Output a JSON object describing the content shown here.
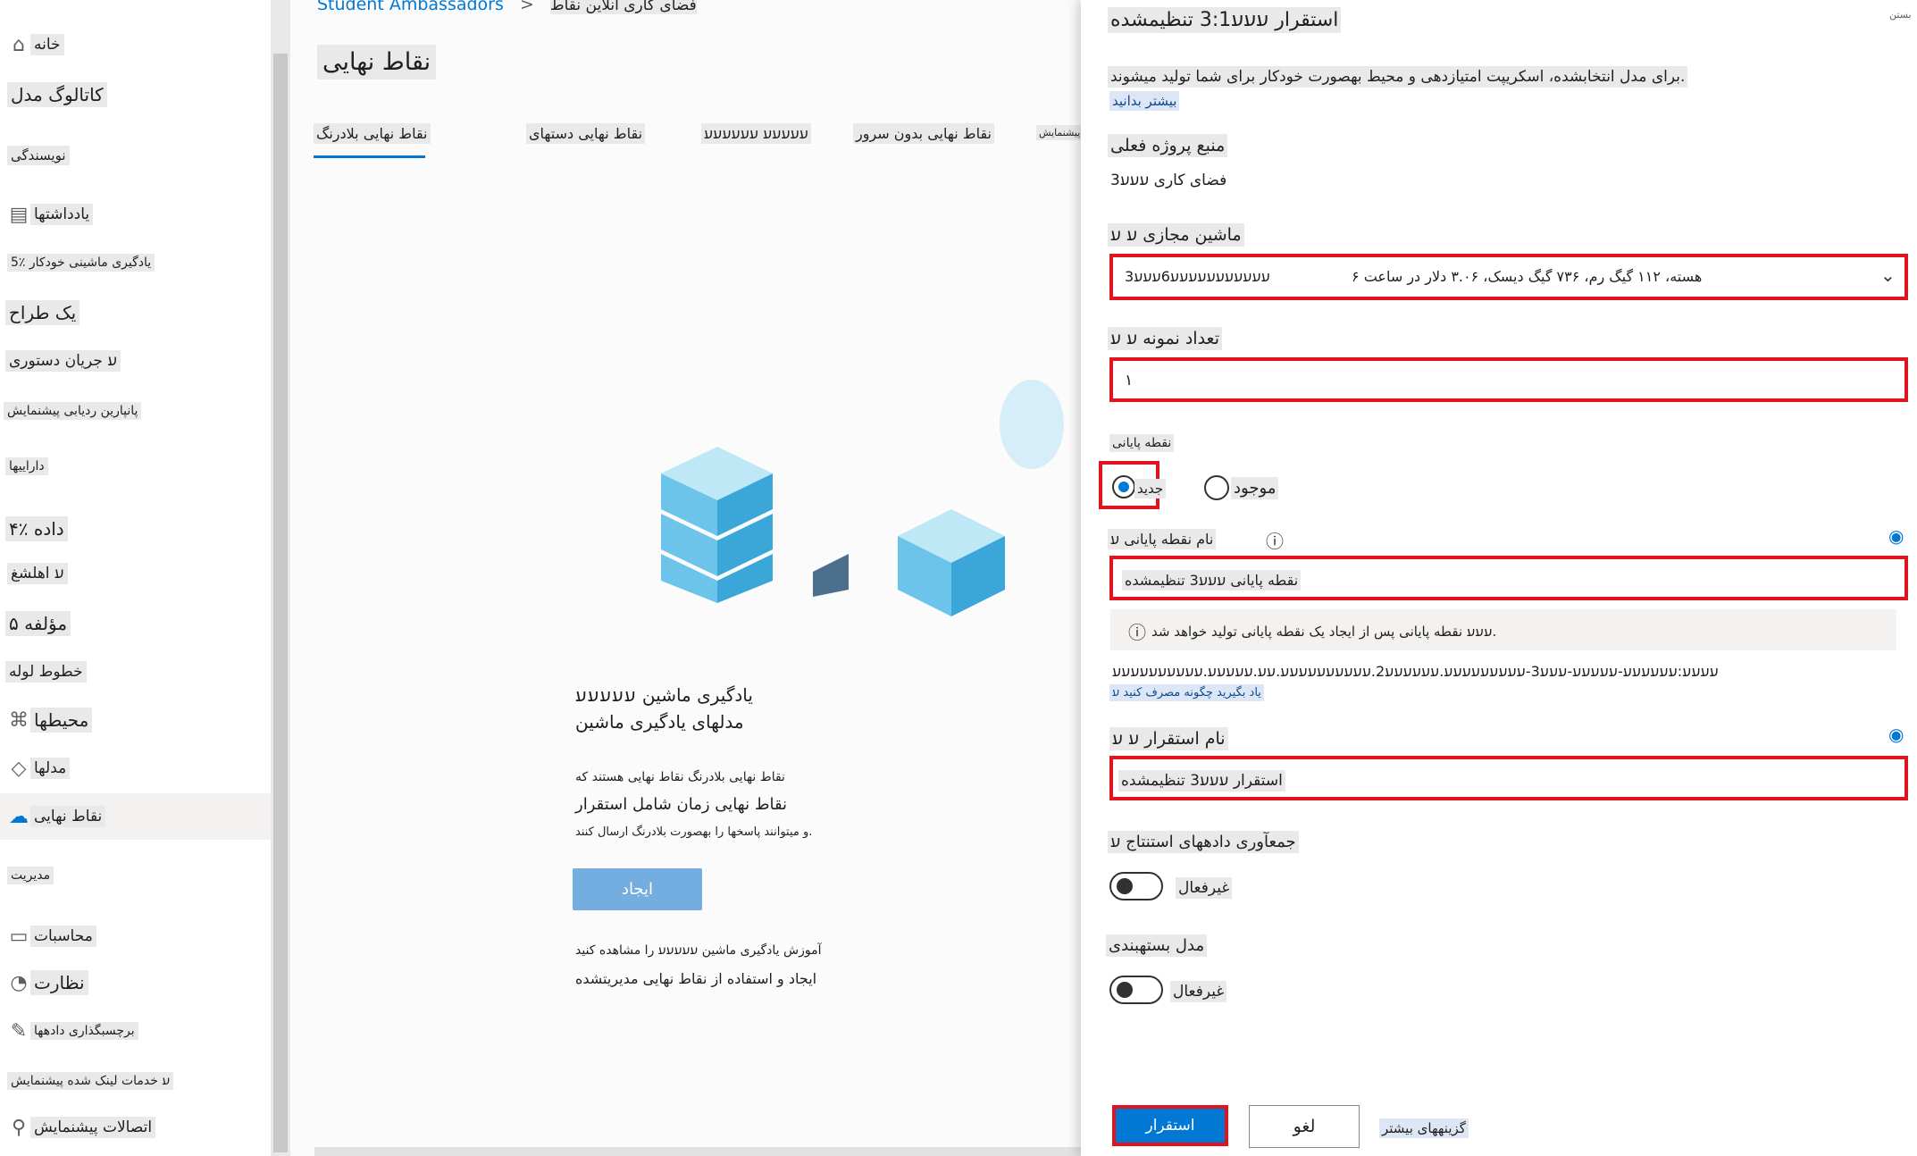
{
  "nav": {
    "items": [
      {
        "label": "خانه",
        "icon": "home-icon"
      },
      {
        "label": "کاتالوگ مدل",
        "icon": ""
      },
      {
        "label": "نویسندگی",
        "icon": ""
      },
      {
        "label": "یادداشتها",
        "icon": "notebook-icon"
      },
      {
        "label": "5٪ یادگیری ماشینی خودکار",
        "icon": ""
      },
      {
        "label": "یک طراح",
        "icon": ""
      },
      {
        "label": "ﬠ جریان دستوری",
        "icon": ""
      },
      {
        "label": "پانپارین ردیابی پیشنمایش",
        "icon": ""
      },
      {
        "label": "داراییها",
        "icon": ""
      },
      {
        "label": "۴٪ داده",
        "icon": ""
      },
      {
        "label": "ﬠ اهلشغ",
        "icon": ""
      },
      {
        "label": "۵ مؤلفه",
        "icon": ""
      },
      {
        "label": "خطوط لوله",
        "icon": ""
      },
      {
        "label": "محیطها",
        "icon": "environment-icon"
      },
      {
        "label": "مدلها",
        "icon": "cube-icon"
      },
      {
        "label": "نقاط نهایی",
        "icon": "endpoint-icon"
      },
      {
        "label": "مدیریت",
        "icon": ""
      },
      {
        "label": "محاسبات",
        "icon": "compute-icon"
      },
      {
        "label": "نظارت",
        "icon": "monitor-icon"
      },
      {
        "label": "برچسبگذاری دادهها",
        "icon": "edit-icon"
      },
      {
        "label": "ﬠ خدمات لینک شده پیشنمایش",
        "icon": ""
      },
      {
        "label": "اتصالات پیشنمایش",
        "icon": "plug-icon"
      }
    ]
  },
  "main": {
    "breadcrumb_root": "Student Ambassadors",
    "breadcrumb_sep": ">",
    "breadcrumb_current": "فضای کاری آنلاین نقاط",
    "title": "نقاط نهایی",
    "tabs": [
      {
        "label": "نقاط نهایی بلادرنگ"
      },
      {
        "label": "نقاط نهایی دستهای"
      },
      {
        "label": "ﬠﬠﬠﬠﬠ ﬠﬠﬠﬠﬠﬠ"
      },
      {
        "label": "نقاط نهایی بدون سرور"
      },
      {
        "label": "پیشنمایش"
      }
    ],
    "empty_title_1": "یادگیری ماشین ﬠﬠﬠﬠﬠ",
    "empty_title_2": "مدلهای یادگیری ماشین",
    "empty_desc_1": "نقاط نهایی بلادرنگ نقاط نهایی هستند که",
    "empty_desc_2": "نقاط نهایی زمان شامل استقرار",
    "empty_desc_3": "و میتوانند پاسخها را بهصورت بلادرنگ ارسال کنند.",
    "create_label": "ایجاد",
    "learn_1": "آموزش یادگیری ماشین ﬠﬠﬠﬠﬠ را مشاهده کنید",
    "learn_2": "ایجاد و استفاده از نقاط نهایی مدیریتشده"
  },
  "panel": {
    "title": "استقرار ﬠﬠﬠ3:1 تنظیمشده",
    "close_label": "بستن",
    "description": "برای مدل انتخابشده، اسکریپت امتیازدهی و محیط بهصورت خودکار برای شما تولید میشوند.",
    "learn_more": "بیشتر بدانید",
    "workspace_label": "منبع پروژه فعلی",
    "workspace_value": "فضای کاری ﬠﬠﬠ3",
    "vm_label": "ماشین مجازی ﬠ ﬠ",
    "vm_name": "ﬠﬠﬠﬠﬠﬠﬠﬠﬠﬠﬠ6ﬠﬠﬠ3",
    "vm_specs": "۶ هسته، ۱۱۲ گیگ رم، ۷۳۶ گیگ دیسک، ۳.۰۶ دلار در ساعت",
    "instance_label": "تعداد نمونه ﬠ ﬠ",
    "instance_value": "۱",
    "endpoint_label": "نقطه پایانی",
    "endpoint_new": "جدید",
    "endpoint_existing": "موجود",
    "endpoint_name_label": "نام نقطه پایانی ﬠ",
    "endpoint_name_value": "نقطه پایانی ﬠﬠﬠ3 تنظیمشده",
    "endpoint_info": "ﬠﬠﬠ نقطه پایانی پس از ایجاد یک نقطه پایانی تولید خواهد شد.",
    "endpoint_uri": "ﬠﬠﬠﬠ:ﬠﬠﬠﬠﬠﬠ-ﬠﬠﬠﬠﬠ-ﬠﬠﬠ3-ﬠﬠﬠﬠﬠﬠﬠﬠﬠ.ﬠﬠﬠﬠﬠﬠ2.ﬠﬠﬠﬠﬠﬠﬠﬠﬠﬠ.ﬠﬠ.ﬠﬠﬠﬠﬠ.ﬠﬠﬠﬠﬠﬠﬠﬠﬠﬠ",
    "uri_help": "یاد بگیرید چگونه مصرف کنید ﬠ",
    "deployment_name_label": "نام استقرار ﬠ ﬠ",
    "deployment_name_value": "استقرار ﬠﬠﬠ3 تنظیمشده",
    "inference_label": "جمعآوری دادههای استنتاج ﬠ",
    "inference_state": "غیرفعال",
    "packaging_label": "مدل بستهبندی",
    "packaging_state": "غیرفعال",
    "deploy_label": "استقرار",
    "cancel_label": "لغو",
    "more_options": "گزینههای بیشتر"
  },
  "colors": {
    "accent": "#0078d4",
    "highlight_red": "#e0131f",
    "create_button": "#74aee0"
  }
}
